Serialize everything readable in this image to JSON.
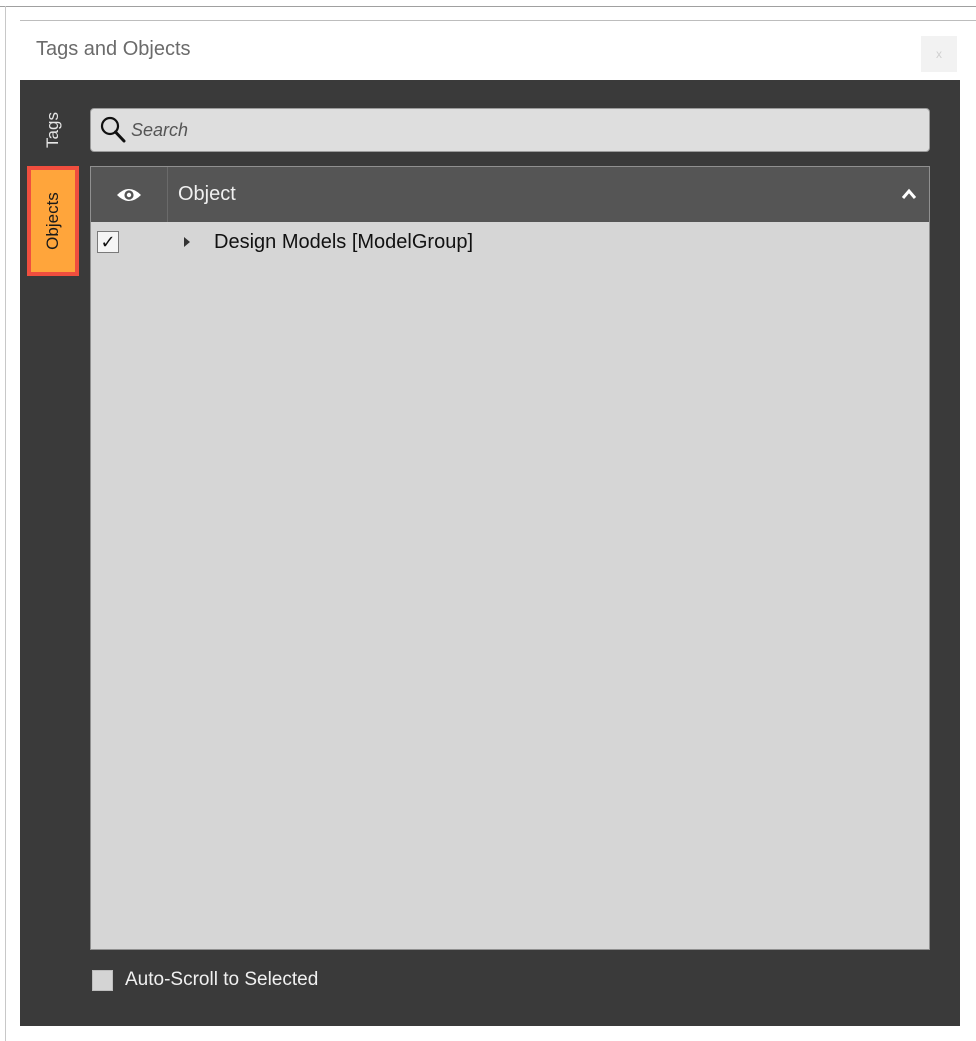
{
  "window": {
    "title": "Tags and Objects",
    "close_label": "x"
  },
  "side_tabs": [
    {
      "label": "Tags",
      "selected": false
    },
    {
      "label": "Objects",
      "selected": true
    }
  ],
  "search": {
    "placeholder": "Search",
    "value": ""
  },
  "grid": {
    "columns": [
      {
        "label": "",
        "icon": "eye-icon"
      },
      {
        "label": "Object",
        "sort": "ascending",
        "sort_icon": "chevron-up-icon"
      }
    ],
    "rows": [
      {
        "checked": true,
        "check_mark": "✓",
        "expanded": false,
        "label": "Design Models [ModelGroup]"
      }
    ]
  },
  "options": {
    "auto_scroll_label": "Auto-Scroll to Selected",
    "auto_scroll_checked": false
  },
  "colors": {
    "panel_bg": "#3a3a3a",
    "grid_bg": "#d6d6d6",
    "header_bg": "#555555",
    "selected_tab": "#ffa53b",
    "highlight_border": "#f04e3e"
  }
}
